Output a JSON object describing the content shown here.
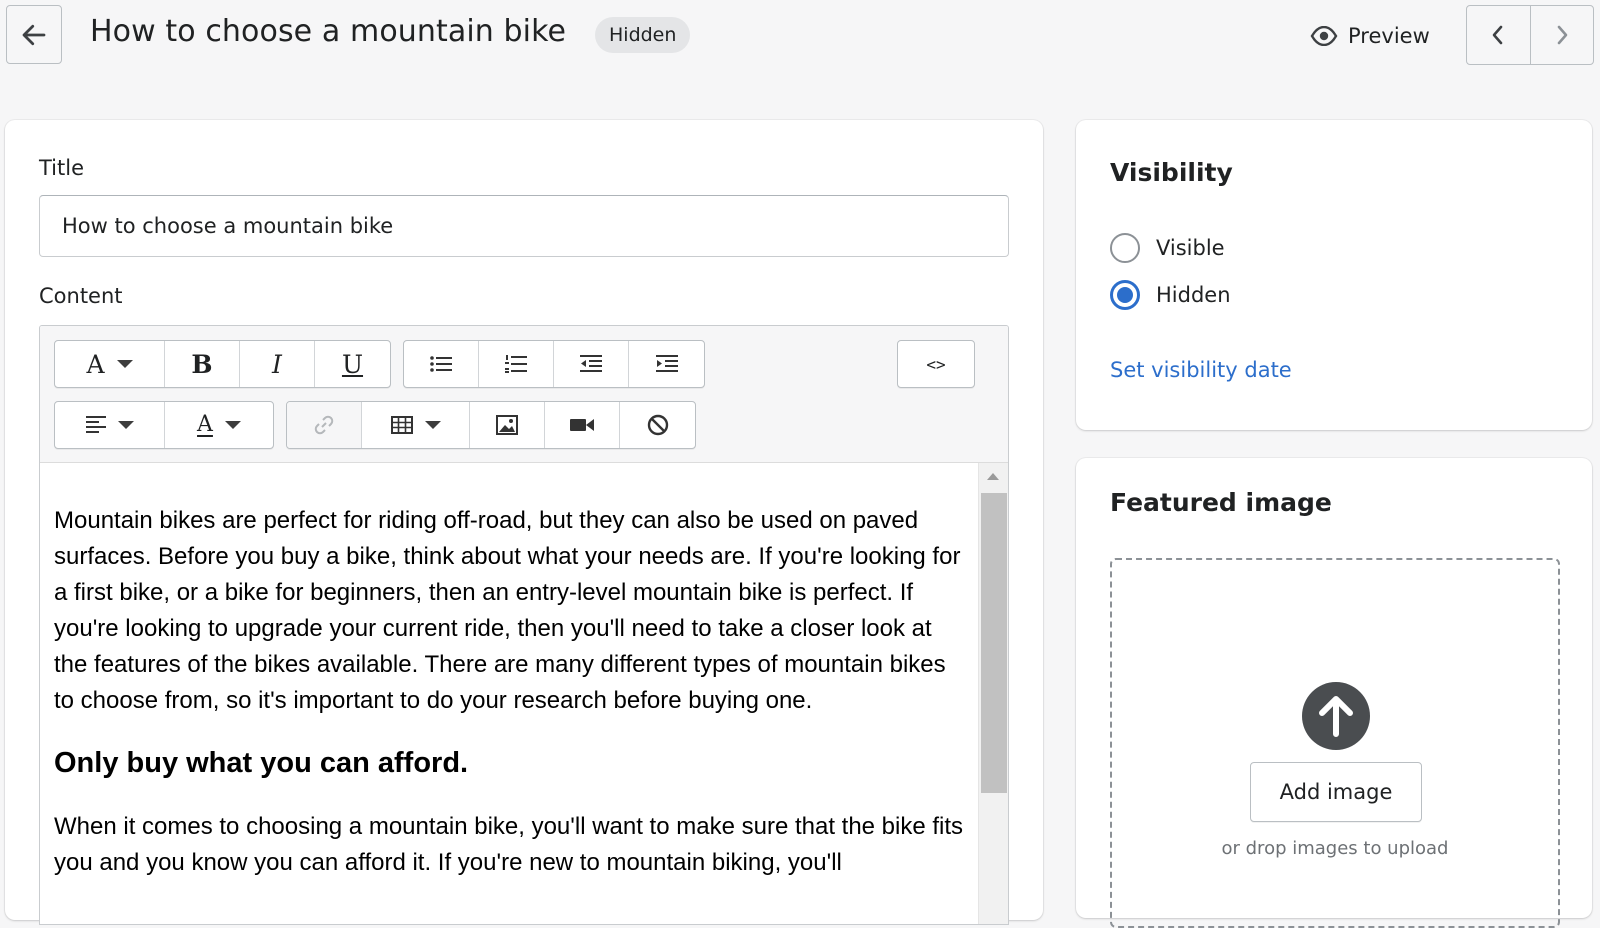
{
  "header": {
    "title": "How to choose a mountain bike",
    "status_badge": "Hidden",
    "preview_label": "Preview",
    "icons": {
      "back": "arrow-left-icon",
      "preview": "eye-icon",
      "prev": "chevron-left-icon",
      "next": "chevron-right-icon"
    }
  },
  "main": {
    "title_label": "Title",
    "title_value": "How to choose a mountain bike",
    "content_label": "Content",
    "toolbar": {
      "row1": [
        "font-style",
        "bold",
        "italic",
        "underline",
        "bullet-list",
        "numbered-list",
        "outdent",
        "indent",
        "html-source"
      ],
      "row2": [
        "align",
        "text-color",
        "link",
        "table",
        "image",
        "video",
        "clear-formatting"
      ],
      "glyphs": {
        "font": "A",
        "bold": "B",
        "italic": "I",
        "underline": "U",
        "source": "<>",
        "color": "A"
      }
    },
    "body": {
      "paragraph1": "Mountain bikes are perfect for riding off-road, but they can also be used on paved surfaces. Before you buy a bike, think about what your needs are. If you're looking for a first bike, or a bike for beginners, then an entry-level mountain bike is perfect. If you're looking to upgrade your current ride, then you'll need to take a closer look at the features of the bikes available. There are many different types of mountain bikes to choose from, so it's important to do your research before buying one.",
      "heading1": "Only buy what you can afford.",
      "paragraph2": "When it comes to choosing a mountain bike, you'll want to make sure that the bike fits you and you know you can afford it. If you're new to mountain biking, you'll"
    }
  },
  "visibility": {
    "heading": "Visibility",
    "options": [
      {
        "label": "Visible",
        "checked": false
      },
      {
        "label": "Hidden",
        "checked": true
      }
    ],
    "set_date_link": "Set visibility date"
  },
  "featured_image": {
    "heading": "Featured image",
    "add_button": "Add image",
    "drop_hint": "or drop images to upload"
  },
  "colors": {
    "accent": "#2c6ecb",
    "background": "#f6f6f7",
    "border": "#babfc3",
    "text": "#202223"
  }
}
